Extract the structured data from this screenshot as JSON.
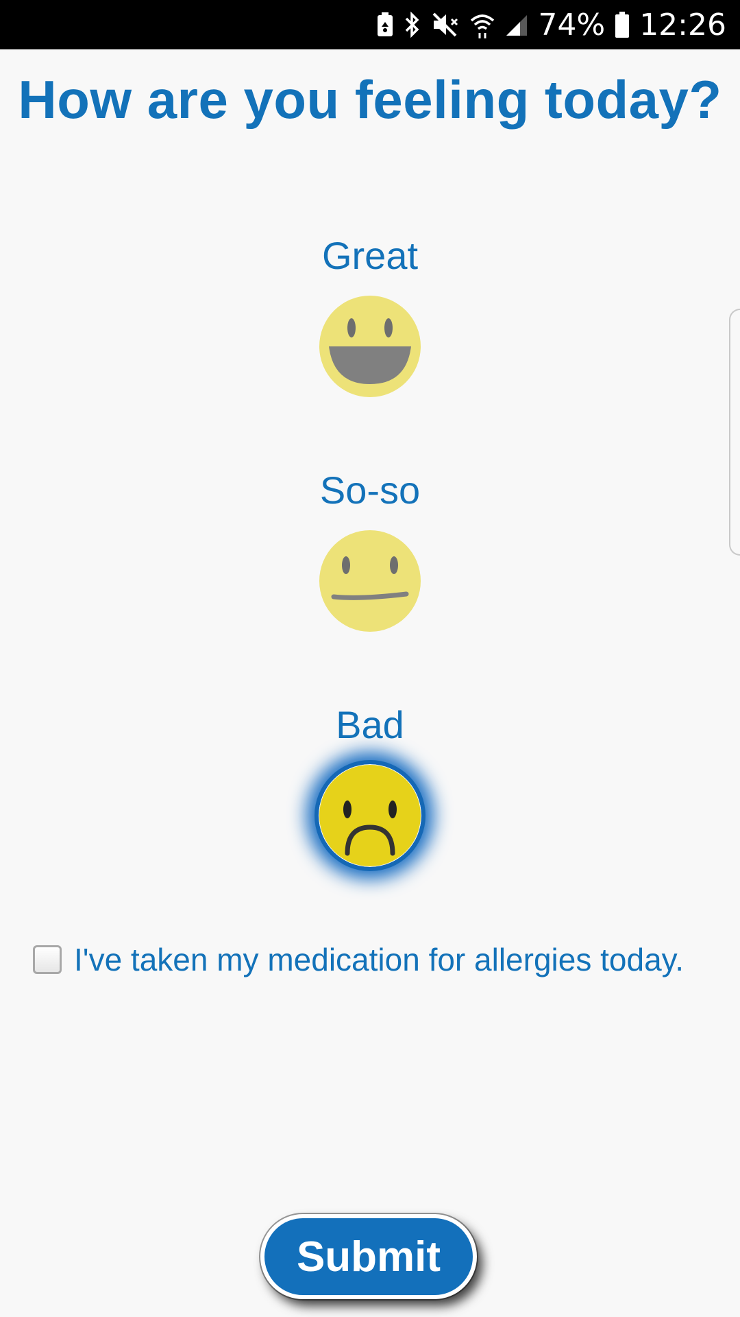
{
  "status_bar": {
    "battery_percent": "74%",
    "time": "12:26",
    "icons": [
      "battery-saver-icon",
      "bluetooth-icon",
      "mute-icon",
      "wifi-icon",
      "signal-icon",
      "battery-icon"
    ]
  },
  "page": {
    "title": "How are you feeling today?"
  },
  "moods": [
    {
      "label": "Great",
      "icon": "grinning-face-icon",
      "selected": false
    },
    {
      "label": "So-so",
      "icon": "neutral-face-icon",
      "selected": false
    },
    {
      "label": "Bad",
      "icon": "sad-face-icon",
      "selected": true
    }
  ],
  "medication": {
    "label": "I've taken my medication for allergies today.",
    "checked": false
  },
  "submit": {
    "label": "Submit"
  },
  "colors": {
    "accent": "#1372b9",
    "background": "#f8f8f8",
    "face_inactive": "#ede278",
    "face_selected": "#e6d21a"
  }
}
